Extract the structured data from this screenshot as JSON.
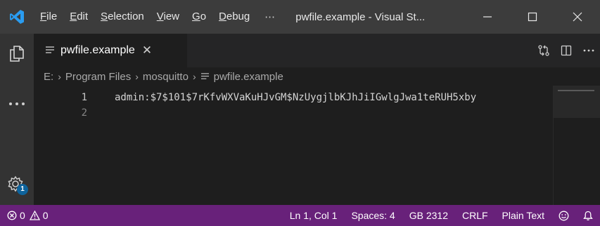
{
  "titlebar": {
    "menu": [
      "File",
      "Edit",
      "Selection",
      "View",
      "Go",
      "Debug"
    ],
    "menu_underline": [
      "F",
      "E",
      "S",
      "V",
      "G",
      "D"
    ],
    "menu_rest": [
      "ile",
      "dit",
      "election",
      "iew",
      "o",
      "ebug"
    ],
    "more": "⋯",
    "title": "pwfile.example - Visual St...",
    "controls": [
      "minimize-icon",
      "maximize-icon",
      "close-icon"
    ]
  },
  "activitybar": {
    "items": [
      "explorer-icon",
      "more-icon"
    ],
    "settings_badge": "1"
  },
  "tab": {
    "label": "pwfile.example",
    "close": "✕"
  },
  "breadcrumb": [
    "E:",
    "Program Files",
    "mosquitto",
    "pwfile.example"
  ],
  "editor": {
    "line_numbers": [
      "1",
      "2"
    ],
    "lines": [
      "admin:$7$101$7rKfvWXVaKuHJvGM$NzUygjlbKJhJiIGwlgJwa1teRUH5xby",
      ""
    ]
  },
  "statusbar": {
    "errors": "0",
    "warnings": "0",
    "position": "Ln 1, Col 1",
    "spaces": "Spaces: 4",
    "encoding": "GB 2312",
    "eol": "CRLF",
    "language": "Plain Text"
  },
  "colors": {
    "statusbar": "#68217a",
    "vscode_blue": "#0e7ad4",
    "badge": "#0e639c"
  }
}
